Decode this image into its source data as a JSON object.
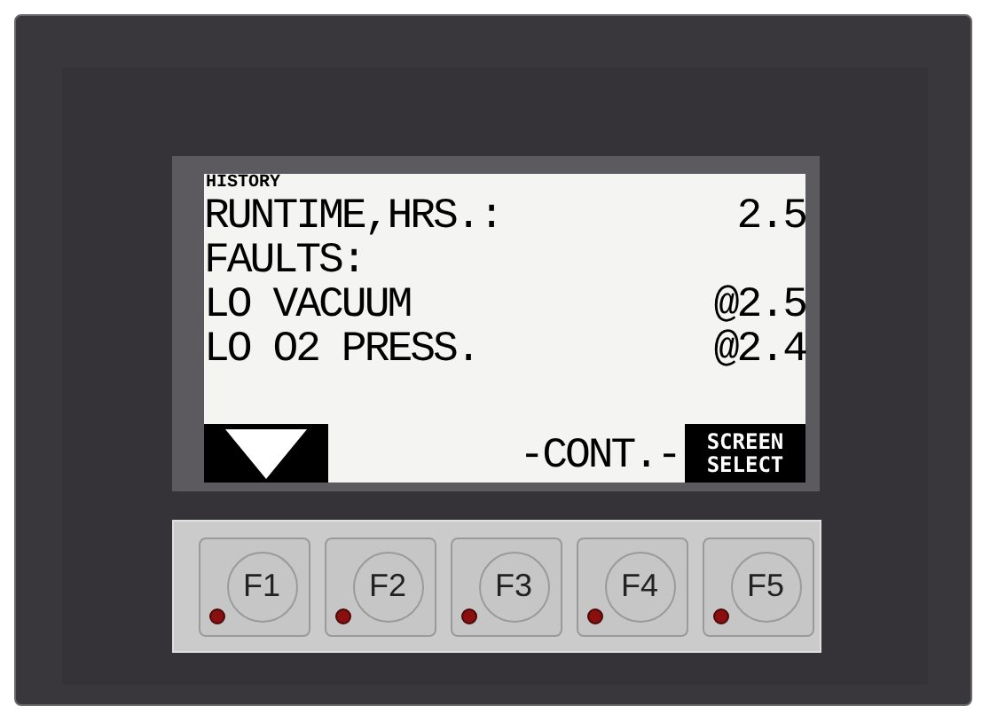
{
  "screen": {
    "title": "HISTORY",
    "rows": [
      {
        "label": "RUNTIME,HRS.:",
        "value": "2.5"
      },
      {
        "label": "FAULTS:",
        "value": ""
      },
      {
        "label": "LO VACUUM",
        "value": "@2.5"
      },
      {
        "label": "LO O2 PRESS.",
        "value": "@2.4"
      }
    ],
    "continue_label": "-CONT.-",
    "screen_select": "SCREEN SELECT"
  },
  "keys": [
    {
      "label": "F1"
    },
    {
      "label": "F2"
    },
    {
      "label": "F3"
    },
    {
      "label": "F4"
    },
    {
      "label": "F5"
    }
  ]
}
